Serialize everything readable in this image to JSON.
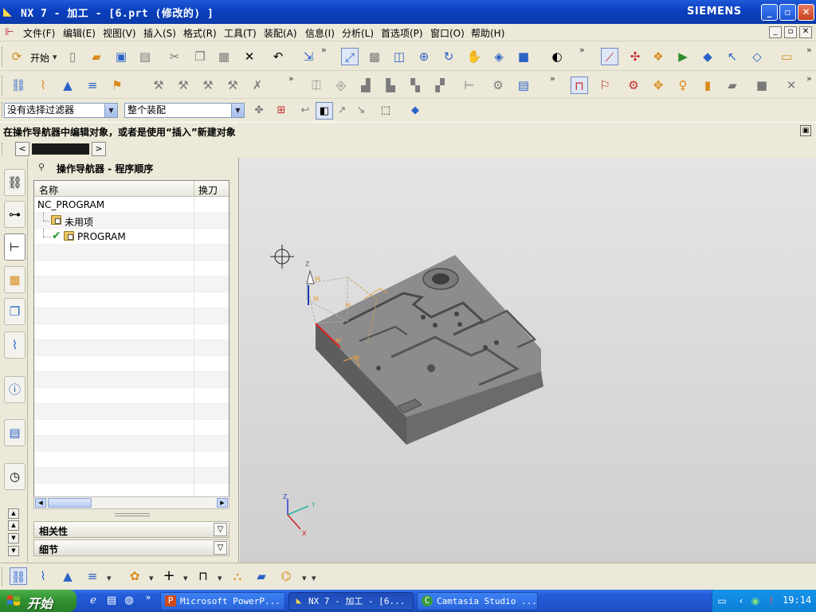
{
  "window": {
    "title": "NX 7 - 加工 - [6.prt (修改的) ]",
    "brand": "SIEMENS",
    "buttons": {
      "minimize": "_",
      "maximize": "▫",
      "close": "✕"
    }
  },
  "menu": {
    "items": [
      "文件(F)",
      "编辑(E)",
      "视图(V)",
      "插入(S)",
      "格式(R)",
      "工具(T)",
      "装配(A)",
      "信息(I)",
      "分析(L)",
      "首选项(P)",
      "窗口(O)",
      "帮助(H)"
    ]
  },
  "toolbar": {
    "start_label": "开始",
    "start_arrow": "▾",
    "overflow": "»"
  },
  "filters": {
    "selection_filter": "没有选择过滤器",
    "assembly_scope": "整个装配"
  },
  "cue_line": "在操作导航器中编辑对象，或者是使用“插入”新建对象",
  "resource_nav": {
    "back": "<",
    "forward": ">"
  },
  "navigator": {
    "title": "操作导航器 - 程序顺序",
    "columns": {
      "name": "名称",
      "tool_change": "换刀"
    },
    "rows": [
      {
        "label": "NC_PROGRAM"
      },
      {
        "label": "未用项"
      },
      {
        "label": "PROGRAM"
      }
    ],
    "sections": {
      "dependencies": "相关性",
      "details": "细节"
    },
    "expand_glyph": "▽"
  },
  "viewport": {
    "axis_labels": {
      "z": "Z",
      "y": "Y",
      "x": "X"
    },
    "wcs_labels": [
      "M",
      "M",
      "M",
      "M",
      "M"
    ]
  },
  "taskbar": {
    "start_label": "开始",
    "quick_launch_overflow": "»",
    "tasks": [
      {
        "label": "Microsoft PowerP..."
      },
      {
        "label": "NX 7 - 加工 - [6..."
      },
      {
        "label": "Camtasia Studio ..."
      }
    ],
    "clock": "19:14"
  },
  "colors": {
    "titlebar": "#0a3fbe",
    "part_top": "#8a8a8a",
    "part_side": "#5f5f5f",
    "wcs_orange": "#e8a33a"
  }
}
